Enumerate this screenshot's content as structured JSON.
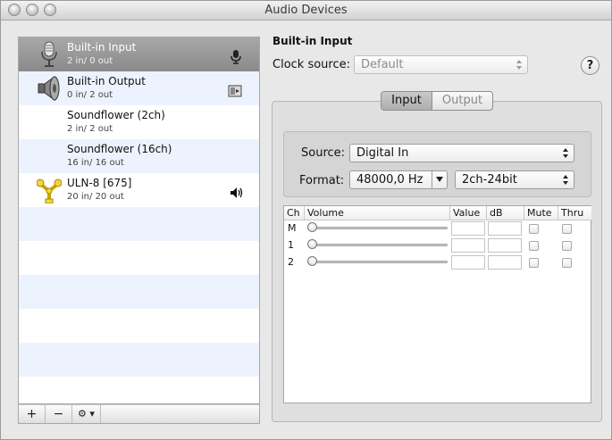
{
  "window": {
    "title": "Audio Devices"
  },
  "devices": [
    {
      "name": "Built-in Input",
      "io": "2 in/ 0 out",
      "icon": "microphone-icon",
      "right_icon": "microphone-small-icon",
      "selected": true
    },
    {
      "name": "Built-in Output",
      "io": "0 in/ 2 out",
      "icon": "speaker-icon",
      "right_icon": "finder-output-icon",
      "selected": false
    },
    {
      "name": "Soundflower (2ch)",
      "io": "2 in/ 2 out",
      "icon": "",
      "right_icon": "",
      "selected": false
    },
    {
      "name": "Soundflower (16ch)",
      "io": "16 in/ 16 out",
      "icon": "",
      "right_icon": "",
      "selected": false
    },
    {
      "name": "ULN-8 [675]",
      "io": "20 in/ 20 out",
      "icon": "firewire-icon",
      "right_icon": "volume-icon",
      "selected": false
    }
  ],
  "list_toolbar": {
    "add": "+",
    "remove": "−",
    "action": "⚙ ▾"
  },
  "detail": {
    "title": "Built-in Input",
    "clock_source_label": "Clock source:",
    "clock_source_value": "Default",
    "help": "?",
    "tabs": [
      "Input",
      "Output"
    ],
    "active_tab": "Input",
    "source_label": "Source:",
    "source_value": "Digital In",
    "format_label": "Format:",
    "format_rate": "48000,0 Hz",
    "format_bits": "2ch-24bit"
  },
  "table": {
    "headers": [
      "Ch",
      "Volume",
      "Value",
      "dB",
      "Mute",
      "Thru"
    ],
    "channels": [
      "M",
      "1",
      "2"
    ]
  }
}
